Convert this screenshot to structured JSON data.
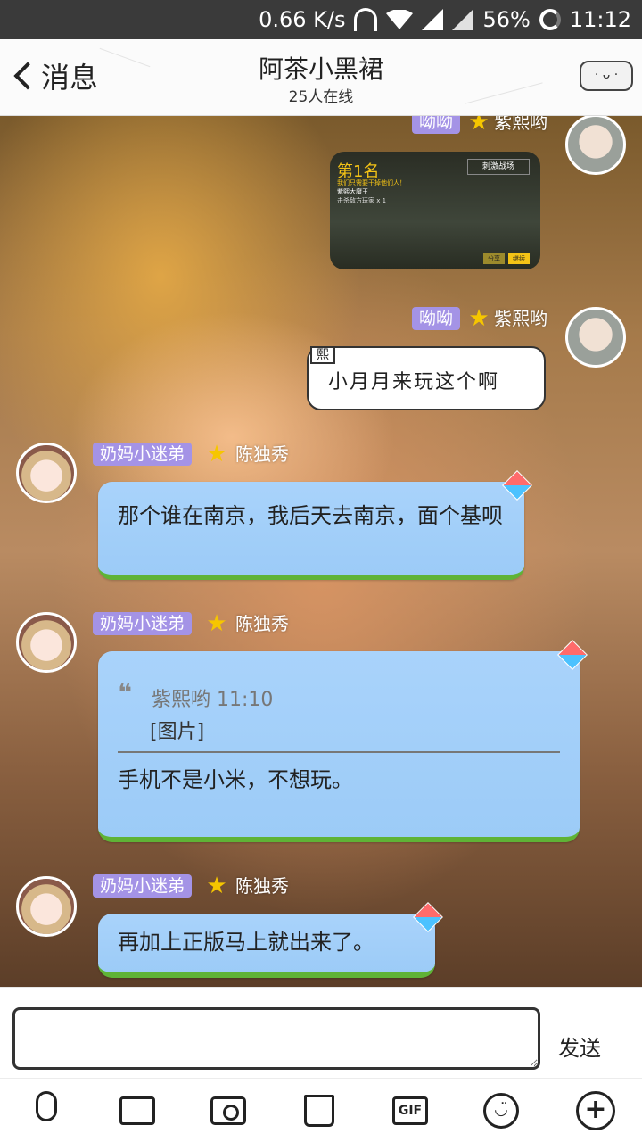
{
  "status": {
    "speed": "0.66 K/s",
    "battery": "56%",
    "time": "11:12"
  },
  "header": {
    "back_label": "消息",
    "title": "阿茶小黑裙",
    "subtitle": "25人在线",
    "menu_icon": "group-menu-icon"
  },
  "messages": [
    {
      "tag": "呦呦",
      "nick": "紫熙哟",
      "type": "image",
      "image": {
        "rank": "第1名",
        "line1": "我们只需要干掉他们人！",
        "line2": "紫熙大魔王",
        "line3": "击杀敌方玩家 x 1",
        "game_logo": "刺激战场",
        "btn1": "分享",
        "btn2": "继续"
      }
    },
    {
      "tag": "呦呦",
      "nick": "紫熙哟",
      "type": "note",
      "badge": "熙",
      "text": "小月月来玩这个啊"
    },
    {
      "tag": "奶妈小迷弟",
      "nick": "陈独秀",
      "type": "text",
      "text": "那个谁在南京，我后天去南京，面个基呗"
    },
    {
      "tag": "奶妈小迷弟",
      "nick": "陈独秀",
      "type": "quote",
      "quote_head": "紫熙哟 11:10",
      "quote_body": "[图片]",
      "text": "手机不是小米，不想玩。"
    },
    {
      "tag": "奶妈小迷弟",
      "nick": "陈独秀",
      "type": "text",
      "text": "再加上正版马上就出来了。"
    }
  ],
  "input": {
    "placeholder": "",
    "send_label": "发送"
  },
  "toolbar": {
    "gif_label": "GIF",
    "smile_label": "◡̈",
    "plus_label": "+"
  },
  "colors": {
    "tag_bg": "#a493e6",
    "bubble_bg": "#a9d3fb",
    "bubble_bottom": "#5fb336",
    "star": "#f6c600"
  }
}
